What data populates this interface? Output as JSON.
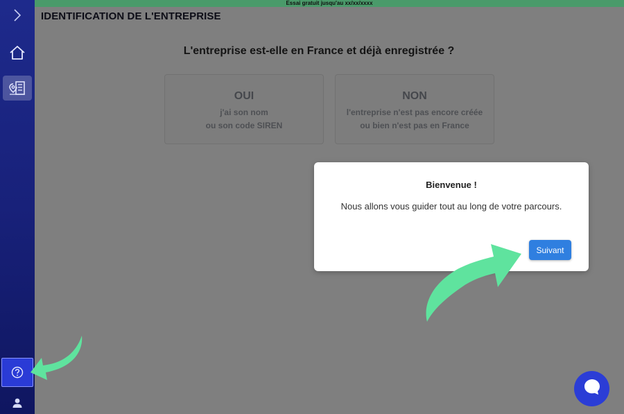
{
  "trial_banner": "Essai gratuit jusqu'au xx/xx/xxxx",
  "page": {
    "title": "IDENTIFICATION DE L'ENTREPRISE",
    "question": "L'entreprise est-elle en France et déjà enregistrée ?"
  },
  "choices": [
    {
      "head": "OUI",
      "line1": "j'ai son nom",
      "line2": "ou son code SIREN"
    },
    {
      "head": "NON",
      "line1": "l'entreprise n'est pas encore créée",
      "line2": "ou bien n'est pas en France"
    }
  ],
  "modal": {
    "title": "Bienvenue !",
    "body": "Nous allons vous guider tout au long de votre parcours.",
    "next_label": "Suivant"
  },
  "sidebar": {
    "icons": [
      "chevron-right-icon",
      "home-icon",
      "company-map-icon",
      "help-icon",
      "user-icon"
    ]
  },
  "colors": {
    "sidebar": "#1e2a8c",
    "accent": "#2f7fe0",
    "arrow": "#5fe39e",
    "trial_bar": "#4a9a6a",
    "chat": "#2b3dd6"
  }
}
